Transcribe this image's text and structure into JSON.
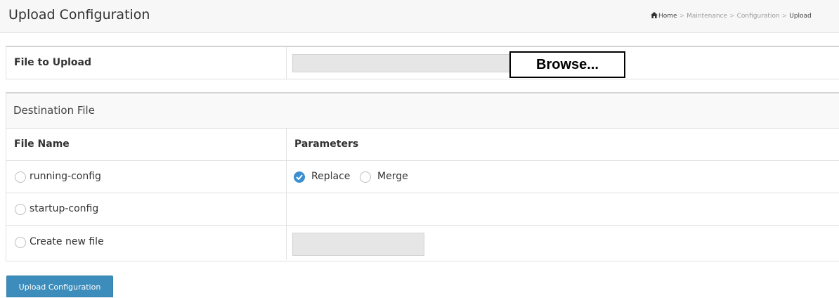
{
  "header": {
    "title": "Upload Configuration",
    "breadcrumb": {
      "home": "Home",
      "items": [
        "Maintenance",
        "Configuration",
        "Upload"
      ],
      "separator": ">",
      "home_icon": "home-icon"
    }
  },
  "upload": {
    "label": "File to Upload",
    "file_path_value": "",
    "browse_label": "Browse..."
  },
  "destination": {
    "heading": "Destination File",
    "columns": {
      "file_name": "File Name",
      "parameters": "Parameters"
    },
    "rows": [
      {
        "name": "running-config",
        "selected": false
      },
      {
        "name": "startup-config",
        "selected": false
      },
      {
        "name": "Create new file",
        "selected": false,
        "new_file_value": ""
      }
    ],
    "parameters": {
      "replace_label": "Replace",
      "merge_label": "Merge",
      "selected": "Replace"
    }
  },
  "actions": {
    "upload_label": "Upload Configuration"
  },
  "colors": {
    "accent": "#3c8dbc",
    "radio_checked": "#3a8fd1"
  }
}
